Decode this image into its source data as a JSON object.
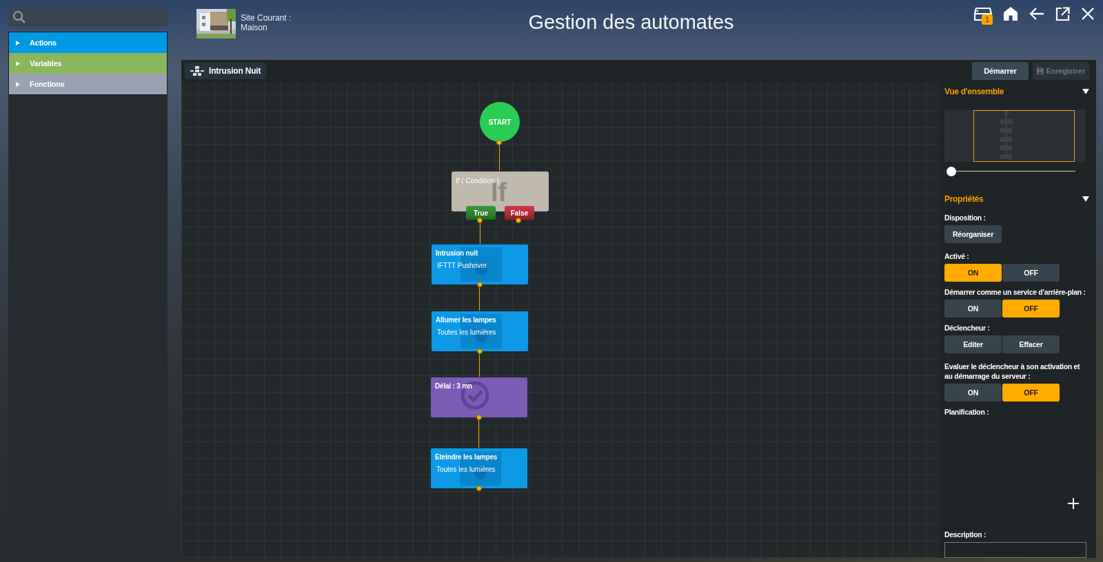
{
  "palette": [
    {
      "label": "Actions",
      "color": "#0099e6"
    },
    {
      "label": "Variables",
      "color": "#8ab65c"
    },
    {
      "label": "Fonctions",
      "color": "#9aa1b3"
    }
  ],
  "site": {
    "label": "Site Courant :",
    "name": "Maison"
  },
  "title": "Gestion des automates",
  "toolbar": {
    "badge": "1"
  },
  "automate": {
    "name": "Intrusion Nuit"
  },
  "actions": [
    {
      "label": "Démarrer",
      "disabled": false
    },
    {
      "label": "Enregistrer",
      "disabled": true
    }
  ],
  "diagram": {
    "start": "START",
    "condition": {
      "label": "If ( Condition )",
      "symbol": "If",
      "true_label": "True",
      "false_label": "False"
    },
    "nodes": [
      {
        "kind": "action",
        "title": "Intrusion nuit",
        "subtitle": "IFTTT Pushover"
      },
      {
        "kind": "action",
        "title": "Allumer les lampes",
        "subtitle": "Toutes les lumières"
      },
      {
        "kind": "delay",
        "title": "Délai : 3 mn"
      },
      {
        "kind": "action",
        "title": "Eteindre les lampes",
        "subtitle": "Toutes les lumières"
      }
    ]
  },
  "overview": {
    "title": "Vue d'ensemble",
    "expanded": true,
    "zoom": {
      "level": 0
    }
  },
  "properties": {
    "title": "Propriétés",
    "expanded": true,
    "sections": [
      {
        "kind": "buttons",
        "label": "Disposition :",
        "buttons": [
          "Réorganiser"
        ]
      },
      {
        "kind": "toggle",
        "label": "Activé :",
        "on_label": "ON",
        "off_label": "OFF",
        "on": true
      },
      {
        "kind": "toggle",
        "label": "Démarrer comme un service d'arrière-plan :",
        "on_label": "ON",
        "off_label": "OFF",
        "on": false
      },
      {
        "kind": "buttons",
        "label": "Déclencheur :",
        "buttons": [
          "Editer",
          "Effacer"
        ]
      },
      {
        "kind": "toggle",
        "label": "Evaluer le déclencheur à son activation et au démarrage du serveur :",
        "on_label": "ON",
        "off_label": "OFF",
        "on": false
      },
      {
        "kind": "empty",
        "label": "Planification :"
      }
    ],
    "description_label": "Description :"
  }
}
